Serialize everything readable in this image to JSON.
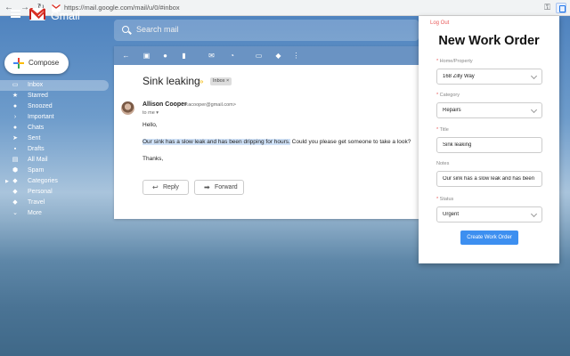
{
  "browser": {
    "url": "https://mail.google.com/mail/u/0/#inbox"
  },
  "gmail": {
    "brand": "Gmail",
    "search_placeholder": "Search mail",
    "compose_label": "Compose",
    "nav": [
      {
        "label": "Inbox",
        "icon": "inbox-icon",
        "active": true
      },
      {
        "label": "Starred",
        "icon": "star-icon"
      },
      {
        "label": "Snoozed",
        "icon": "clock-icon"
      },
      {
        "label": "Important",
        "icon": "important-icon"
      },
      {
        "label": "Chats",
        "icon": "chat-icon"
      },
      {
        "label": "Sent",
        "icon": "send-icon"
      },
      {
        "label": "Drafts",
        "icon": "draft-icon"
      },
      {
        "label": "All Mail",
        "icon": "all-mail-icon"
      },
      {
        "label": "Spam",
        "icon": "spam-icon"
      },
      {
        "label": "Categories",
        "icon": "label-icon"
      },
      {
        "label": "Personal",
        "icon": "label-icon"
      },
      {
        "label": "Travel",
        "icon": "label-icon"
      },
      {
        "label": "More",
        "icon": "chevron-down-icon"
      }
    ]
  },
  "email": {
    "subject": "Sink leaking",
    "label_chip": "Inbox ×",
    "sender_name": "Allison Cooper",
    "sender_email": "<acooper@gmail.com>",
    "to": "to me ▾",
    "greeting": "Hello,",
    "body_highlight": "Our sink has a slow leak and has been dripping for hours.",
    "body_rest": " Could you please get someone to take a look?",
    "signoff": "Thanks,",
    "reply_label": "Reply",
    "forward_label": "Forward"
  },
  "popup": {
    "logout": "Log Out",
    "title": "New Work Order",
    "fields": {
      "home_label": "Home/Property",
      "home_value": "168 Zilly Way",
      "category_label": "Category",
      "category_value": "Repairs",
      "title_label": "Title",
      "title_value": "Sink leaking",
      "notes_label": "Notes",
      "notes_value": "Our sink has a slow leak and has been dripping for hours.",
      "status_label": "Status",
      "status_value": "Urgent"
    },
    "required_mark": "*",
    "submit_label": "Create Work Order"
  },
  "colors": {
    "accent": "#3d8ff0",
    "logout": "#e85a5a",
    "gmail_red": "#d93025"
  }
}
